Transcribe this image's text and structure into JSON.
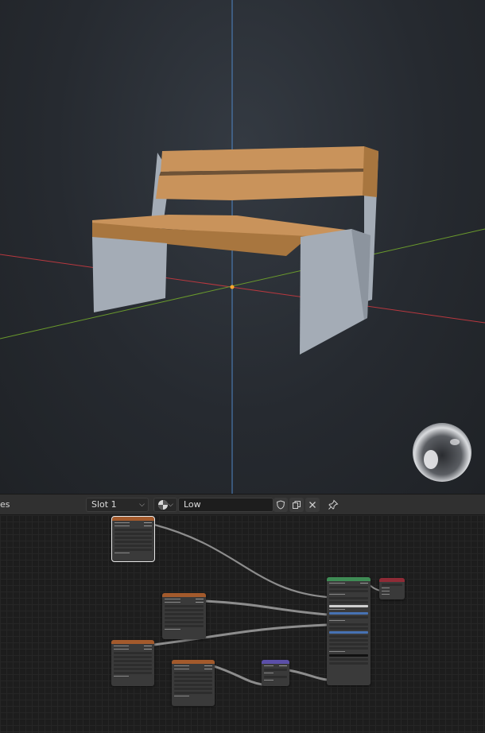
{
  "viewport": {
    "colors": {
      "x_axis": "#b8383f",
      "y_axis": "#6a9a2c",
      "z_axis": "#4f86c6",
      "wood": "#c9935b",
      "metal": "#a4acb6",
      "origin": "#ffa72b"
    },
    "matball_icon": "matcap-sphere-icon"
  },
  "header": {
    "left_text": "es",
    "slot": "Slot 1",
    "shading_icon": "material-sphere-icon",
    "material_name": "Low",
    "fake_user_icon": "shield-icon",
    "duplicate_icon": "copy-icon",
    "unlink_icon": "close-icon",
    "pin_icon": "pin-icon"
  },
  "node_editor": {
    "colors": {
      "texture_header": "#a35a2c",
      "shader_header": "#3f8c55",
      "output_header": "#8f2b36",
      "vector_header": "#5b4fa8",
      "wire": "#8d8d8d"
    },
    "nodes": [
      {
        "kind": "image-texture"
      },
      {
        "kind": "image-texture"
      },
      {
        "kind": "image-texture"
      },
      {
        "kind": "image-texture"
      },
      {
        "kind": "normal-map"
      },
      {
        "kind": "principled-bsdf"
      },
      {
        "kind": "material-output"
      }
    ]
  }
}
